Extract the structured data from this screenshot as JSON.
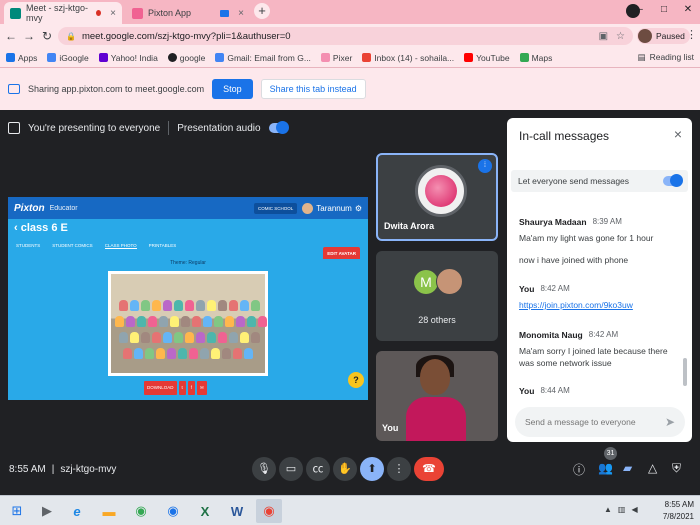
{
  "browser": {
    "tabs": [
      {
        "title": "Meet - szj-ktgo-mvy",
        "close": "×"
      },
      {
        "title": "Pixton App",
        "close": "×"
      }
    ],
    "new_tab": "+",
    "url": "meet.google.com/szj-ktgo-mvy?pli=1&authuser=0",
    "profile_status": "Paused",
    "window_controls": [
      "–",
      "□",
      "✕"
    ],
    "nav": {
      "back": "←",
      "forward": "→",
      "reload": "↻",
      "menu": "⋮"
    },
    "bookmarks": [
      "Apps",
      "iGoogle",
      "Yahoo! India",
      "google",
      "Gmail: Email from G...",
      "Pixer",
      "Inbox (14) - sohaila...",
      "YouTube",
      "Maps"
    ],
    "reading_list": "Reading list"
  },
  "share_bar": {
    "text": "Sharing app.pixton.com to meet.google.com",
    "stop_label": "Stop",
    "share_this_label": "Share this tab instead"
  },
  "meet": {
    "presenting_text": "You're presenting to everyone",
    "presentation_audio": "Presentation audio",
    "meeting_time": "8:55 AM",
    "meeting_code": "szj-ktgo-mvy",
    "people_count": "31",
    "tiles": [
      {
        "name": "Dwita Arora"
      },
      {
        "name": "28 others",
        "initial": "M"
      },
      {
        "name": "You"
      }
    ]
  },
  "pixton": {
    "logo": "Pixton",
    "role": "Educator",
    "comic_school": "COMIC SCHOOL",
    "user": "Tarannum",
    "class_title": "class 6 E",
    "tabs": [
      "STUDENTS",
      "STUDENT COMICS",
      "CLASS PHOTO",
      "PRINTABLES"
    ],
    "edit_avatar": "EDIT AVATAR",
    "theme": "Theme: Regular",
    "download": "DOWNLOAD",
    "help": "?"
  },
  "chat": {
    "title": "In-call messages",
    "close": "×",
    "setting_label": "Let everyone send messages",
    "messages": [
      {
        "name": "Shaurya Madaan",
        "time": "8:39 AM",
        "lines": [
          "Ma'am my light was gone for 1 hour",
          "now i have joined with phone"
        ]
      },
      {
        "name": "You",
        "time": "8:42 AM",
        "link": "https://join.pixton.com/9ko3uw"
      },
      {
        "name": "Monomita Naug",
        "time": "8:42 AM",
        "lines": [
          "Ma'am sorry I joined late because there was some network issue"
        ]
      },
      {
        "name": "You",
        "time": "8:44 AM"
      }
    ],
    "input_placeholder": "Send a message to everyone",
    "send": "➤"
  },
  "taskbar": {
    "time": "8:55 AM",
    "date": "7/8/2021"
  },
  "colors": {
    "chrome_tab": "#f6b6c3",
    "chrome_toolbar": "#fde8ec",
    "meet_bg": "#202124",
    "accent": "#1a73e8",
    "end_call": "#ea4335",
    "pixton_blue": "#29a9e8"
  }
}
